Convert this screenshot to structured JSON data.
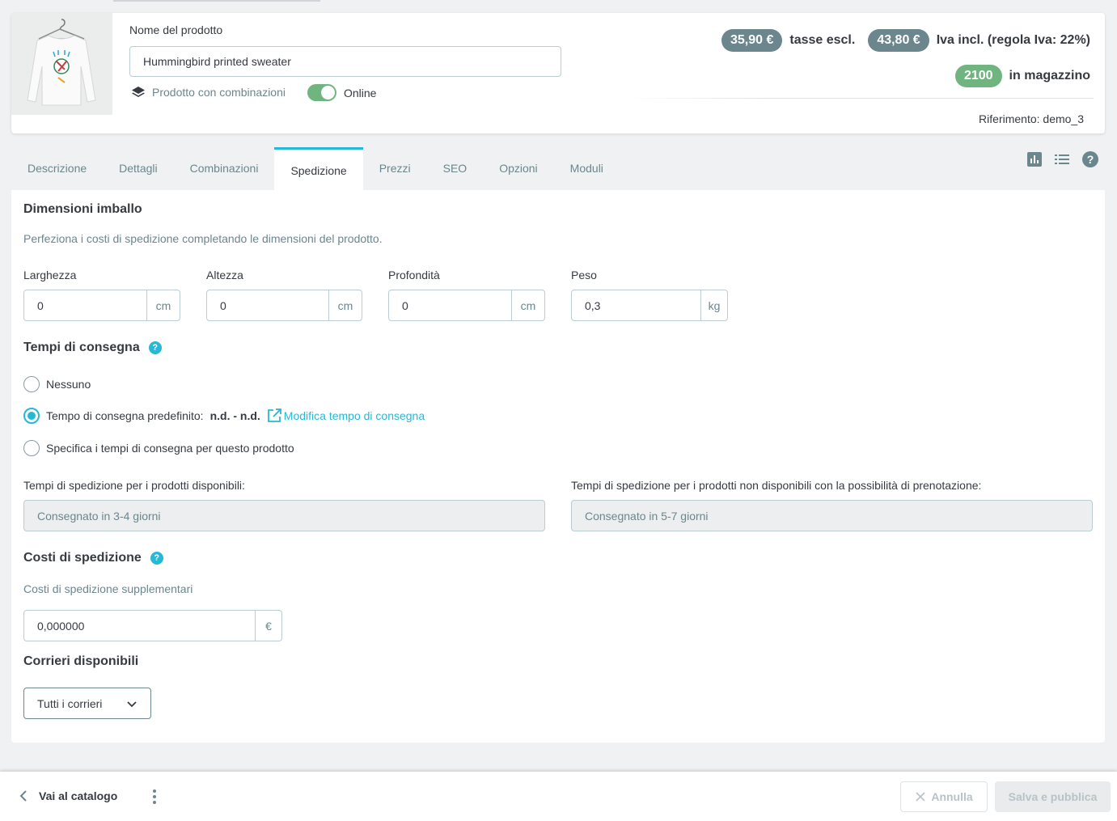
{
  "header": {
    "name_label": "Nome del prodotto",
    "name_value": "Hummingbird printed sweater",
    "combinations_label": "Prodotto con combinazioni",
    "online_label": "Online",
    "price_excl": "35,90 €",
    "price_excl_label": "tasse escl.",
    "price_incl": "43,80 €",
    "price_incl_label": "Iva incl. (regola Iva: 22%)",
    "stock": "2100",
    "stock_label": "in magazzino",
    "reference": "Riferimento: demo_3",
    "online_enabled": true
  },
  "tabs": [
    {
      "label": "Descrizione"
    },
    {
      "label": "Dettagli"
    },
    {
      "label": "Combinazioni"
    },
    {
      "label": "Spedizione",
      "active": true
    },
    {
      "label": "Prezzi"
    },
    {
      "label": "SEO"
    },
    {
      "label": "Opzioni"
    },
    {
      "label": "Moduli"
    }
  ],
  "tab_icons": [
    "bar-chart-icon",
    "list-icon",
    "help-icon"
  ],
  "dimensions": {
    "title": "Dimensioni imballo",
    "help": "Perfeziona i costi di spedizione completando le dimensioni del prodotto.",
    "fields": [
      {
        "label": "Larghezza",
        "value": "0",
        "unit": "cm"
      },
      {
        "label": "Altezza",
        "value": "0",
        "unit": "cm"
      },
      {
        "label": "Profondità",
        "value": "0",
        "unit": "cm"
      },
      {
        "label": "Peso",
        "value": "0,3",
        "unit": "kg"
      }
    ]
  },
  "delivery": {
    "title": "Tempi di consegna",
    "options": [
      {
        "label": "Nessuno",
        "checked": false
      },
      {
        "label": "Tempo di consegna predefinito:",
        "value": "n.d. - n.d.",
        "checked": true
      },
      {
        "label": "Specifica i tempi di consegna per questo prodotto",
        "checked": false
      }
    ],
    "edit_link": "Modifica tempo di consegna",
    "available_label": "Tempi di spedizione per i prodotti disponibili:",
    "available_value": "Consegnato in 3-4 giorni",
    "oos_label": "Tempi di spedizione per i prodotti non disponibili con la possibilità di prenotazione:",
    "oos_value": "Consegnato in 5-7 giorni"
  },
  "costs": {
    "title": "Costi di spedizione",
    "help": "Costi di spedizione supplementari",
    "value": "0,000000",
    "unit": "€"
  },
  "carriers": {
    "title": "Corrieri disponibili",
    "selected": "Tutti i corrieri"
  },
  "footer": {
    "back_label": "Vai al catalogo",
    "cancel_label": "Annulla",
    "save_label": "Salva e pubblica"
  },
  "colors": {
    "accent": "#25b9d7",
    "success": "#70b580",
    "pill_gray": "#6c868e"
  }
}
